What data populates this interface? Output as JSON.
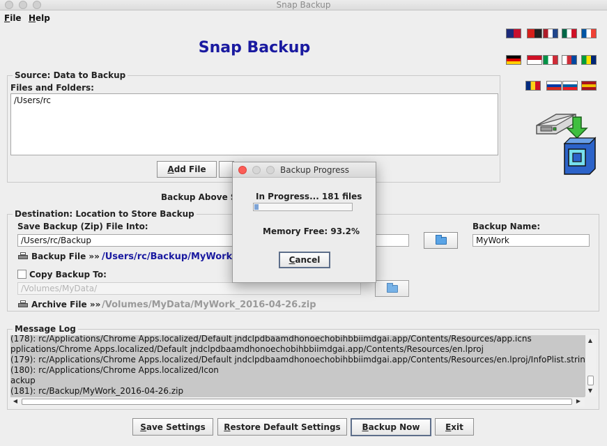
{
  "window": {
    "title": "Snap Backup"
  },
  "menu": {
    "file": "File",
    "help": "Help"
  },
  "app_title": "Snap Backup",
  "flags": [
    {
      "name": "flag-new-zealand",
      "colors": [
        "#1c2a7a",
        "#c8102e"
      ]
    },
    {
      "name": "flag-albania",
      "colors": [
        "#d6201a",
        "#222222"
      ]
    },
    {
      "name": "flag-netherlands",
      "colors": [
        "#ae1c28",
        "#ffffff",
        "#21468b"
      ]
    },
    {
      "name": "flag-mexico",
      "colors": [
        "#006847",
        "#ffffff",
        "#ce1126"
      ]
    },
    {
      "name": "flag-france",
      "colors": [
        "#0055a4",
        "#ffffff",
        "#ef4135"
      ]
    },
    {
      "name": "flag-germany",
      "colors": [
        "#000000",
        "#dd0000",
        "#ffce00"
      ]
    },
    {
      "name": "flag-indonesia",
      "colors": [
        "#ce1126",
        "#ffffff"
      ]
    },
    {
      "name": "flag-italy",
      "colors": [
        "#009246",
        "#ffffff",
        "#ce2b37"
      ]
    },
    {
      "name": "flag-south-korea",
      "colors": [
        "#ffffff",
        "#cd2e3a",
        "#0047a0"
      ]
    },
    {
      "name": "flag-brazil",
      "colors": [
        "#009c3b",
        "#ffdf00",
        "#002776"
      ]
    },
    {
      "name": "flag-romania",
      "colors": [
        "#002b7f",
        "#fcd116",
        "#ce1126"
      ]
    },
    {
      "name": "flag-russia",
      "colors": [
        "#ffffff",
        "#0039a6",
        "#d52b1e"
      ]
    },
    {
      "name": "flag-slovenia",
      "colors": [
        "#ffffff",
        "#005da4",
        "#ed1c24"
      ]
    },
    {
      "name": "flag-spain",
      "colors": [
        "#aa151b",
        "#f1bf00",
        "#aa151b"
      ]
    }
  ],
  "source": {
    "group_title": "Source: Data to Backup",
    "files_label": "Files and Folders:",
    "files": [
      "/Users/rc"
    ],
    "add_file_button": "Add File",
    "backup_above_label": "Backup Above Se"
  },
  "destination": {
    "group_title": "Destination: Location to Store Backup",
    "save_label": "Save Backup (Zip) File Into:",
    "save_path": "/Users/rc/Backup",
    "backup_name_label": "Backup Name:",
    "backup_name": "MyWork",
    "backup_file_label": "Backup File »»",
    "backup_file_path": "/Users/rc/Backup/MyWork_",
    "copy_label": "Copy Backup To:",
    "copy_path": "/Volumes/MyData/",
    "archive_label": "Archive File »»",
    "archive_path": "/Volumes/MyData/MyWork_2016-04-26.zip"
  },
  "log": {
    "group_title": "Message Log",
    "lines": [
      "(178): rc/Applications/Chrome Apps.localized/Default jndclpdbaamdhonoechobihbbiimdgai.app/Contents/Resources/app.icns",
      "pplications/Chrome Apps.localized/Default jndclpdbaamdhonoechobihbbiimdgai.app/Contents/Resources/en.lproj",
      "(179): rc/Applications/Chrome Apps.localized/Default jndclpdbaamdhonoechobihbbiimdgai.app/Contents/Resources/en.lproj/InfoPlist.strings",
      "(180): rc/Applications/Chrome Apps.localized/Icon",
      "ackup",
      "(181): rc/Backup/MyWork_2016-04-26.zip"
    ]
  },
  "buttons": {
    "save_settings": "Save Settings",
    "restore_defaults": "Restore Default Settings",
    "backup_now": "Backup Now",
    "exit": "Exit"
  },
  "dialog": {
    "title": "Backup Progress",
    "status": "In Progress... 181 files",
    "progress_fraction": 0.03,
    "memory": "Memory Free: 93.2%",
    "cancel": "Cancel"
  },
  "colors": {
    "accent_title": "#1a1aa0",
    "link_path": "#1a1aa0",
    "log_background": "#c8c8c8",
    "progress_fill": "#7ea4d6"
  }
}
